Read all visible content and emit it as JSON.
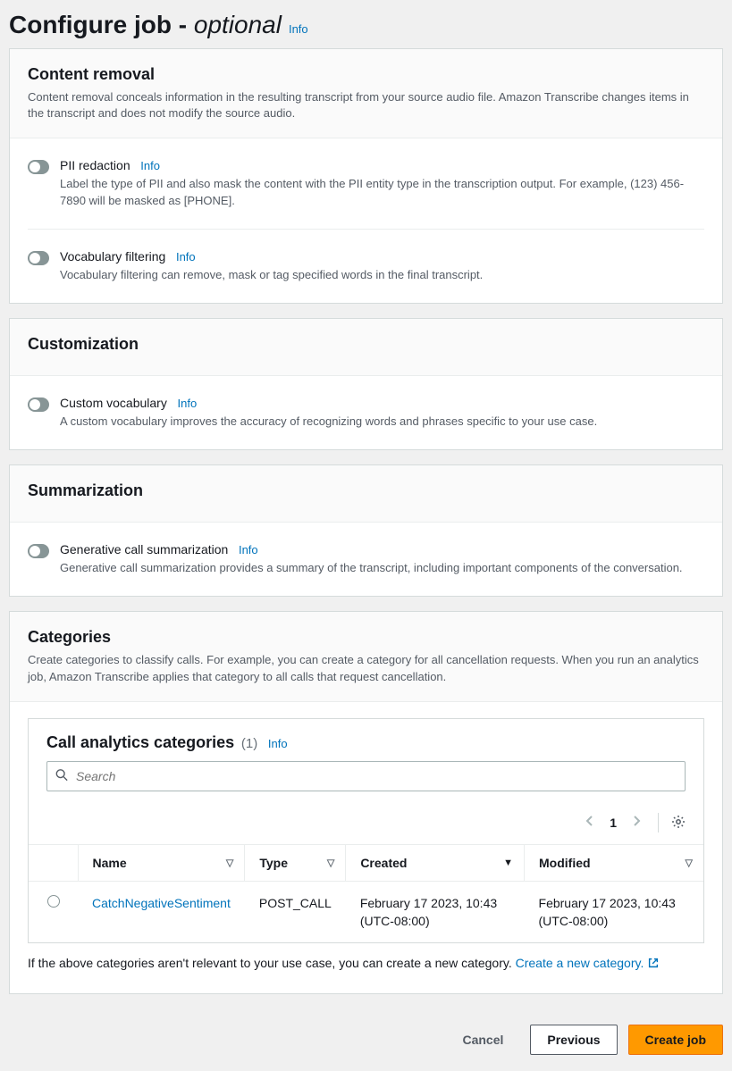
{
  "page": {
    "title_prefix": "Configure job",
    "title_sep": " - ",
    "title_optional": "optional",
    "info": "Info"
  },
  "sections": {
    "content_removal": {
      "title": "Content removal",
      "desc": "Content removal conceals information in the resulting transcript from your source audio file. Amazon Transcribe changes items in the transcript and does not modify the source audio.",
      "pii": {
        "label": "PII redaction",
        "info": "Info",
        "desc": "Label the type of PII and also mask the content with the PII entity type in the transcription output. For example, (123) 456-7890 will be masked as [PHONE]."
      },
      "vocab_filter": {
        "label": "Vocabulary filtering",
        "info": "Info",
        "desc": "Vocabulary filtering can remove, mask or tag specified words in the final transcript."
      }
    },
    "customization": {
      "title": "Customization",
      "custom_vocab": {
        "label": "Custom vocabulary",
        "info": "Info",
        "desc": "A custom vocabulary improves the accuracy of recognizing words and phrases specific to your use case."
      }
    },
    "summarization": {
      "title": "Summarization",
      "gen": {
        "label": "Generative call summarization",
        "info": "Info",
        "desc": "Generative call summarization provides a summary of the transcript, including important components of the conversation."
      }
    },
    "categories": {
      "title": "Categories",
      "desc": "Create categories to classify calls. For example, you can create a category for all cancellation requests. When you run an analytics job, Amazon Transcribe applies that category to all calls that request cancellation.",
      "table_title": "Call analytics categories",
      "count": "(1)",
      "info": "Info",
      "search_placeholder": "Search",
      "page": "1",
      "columns": {
        "name": "Name",
        "type": "Type",
        "created": "Created",
        "modified": "Modified"
      },
      "rows": [
        {
          "name": "CatchNegativeSentiment",
          "type": "POST_CALL",
          "created": "February 17 2023, 10:43 (UTC-08:00)",
          "modified": "February 17 2023, 10:43 (UTC-08:00)"
        }
      ],
      "footer_text": "If the above categories aren't relevant to your use case, you can create a new category. ",
      "create_link": "Create a new category."
    }
  },
  "buttons": {
    "cancel": "Cancel",
    "previous": "Previous",
    "create": "Create job"
  }
}
